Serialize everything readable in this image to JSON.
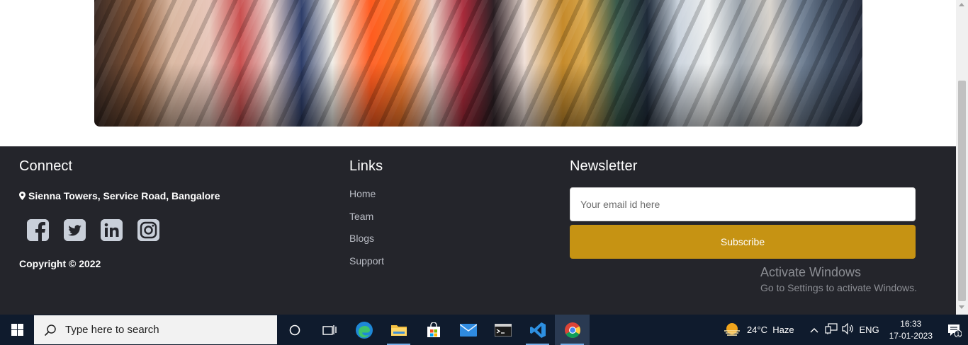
{
  "footer": {
    "connect": {
      "title": "Connect",
      "address": "Sienna Towers, Service Road, Bangalore",
      "socials": [
        "facebook-icon",
        "twitter-icon",
        "linkedin-icon",
        "instagram-icon"
      ],
      "copyright": "Copyright © 2022"
    },
    "links": {
      "title": "Links",
      "items": [
        "Home",
        "Team",
        "Blogs",
        "Support"
      ]
    },
    "newsletter": {
      "title": "Newsletter",
      "email_placeholder": "Your email id here",
      "subscribe_label": "Subscribe"
    }
  },
  "watermark": {
    "line1": "Activate Windows",
    "line2": "Go to Settings to activate Windows."
  },
  "taskbar": {
    "search_placeholder": "Type here to search",
    "weather": "24°C  Haze",
    "language": "ENG",
    "time": "16:33",
    "date": "17-01-2023",
    "notification_count": "1"
  },
  "colors": {
    "footer_bg": "#24252b",
    "subscribe_bg": "#c69313",
    "taskbar_bg": "#0f1b2d"
  }
}
